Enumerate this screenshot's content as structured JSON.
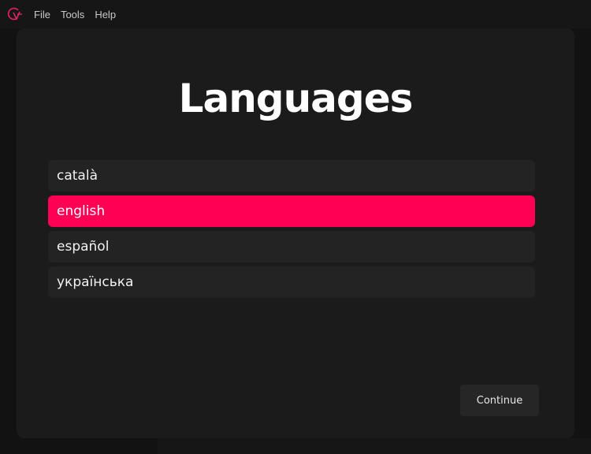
{
  "app": {
    "logo_icon": "app-logo-icon",
    "accent_color": "#ff0055"
  },
  "menubar": {
    "items": [
      {
        "label": "File"
      },
      {
        "label": "Tools"
      },
      {
        "label": "Help"
      }
    ]
  },
  "dialog": {
    "title": "Languages",
    "languages": [
      {
        "label": "català",
        "selected": false
      },
      {
        "label": "english",
        "selected": true
      },
      {
        "label": "español",
        "selected": false
      },
      {
        "label": "українська",
        "selected": false
      }
    ],
    "continue_label": "Continue"
  }
}
